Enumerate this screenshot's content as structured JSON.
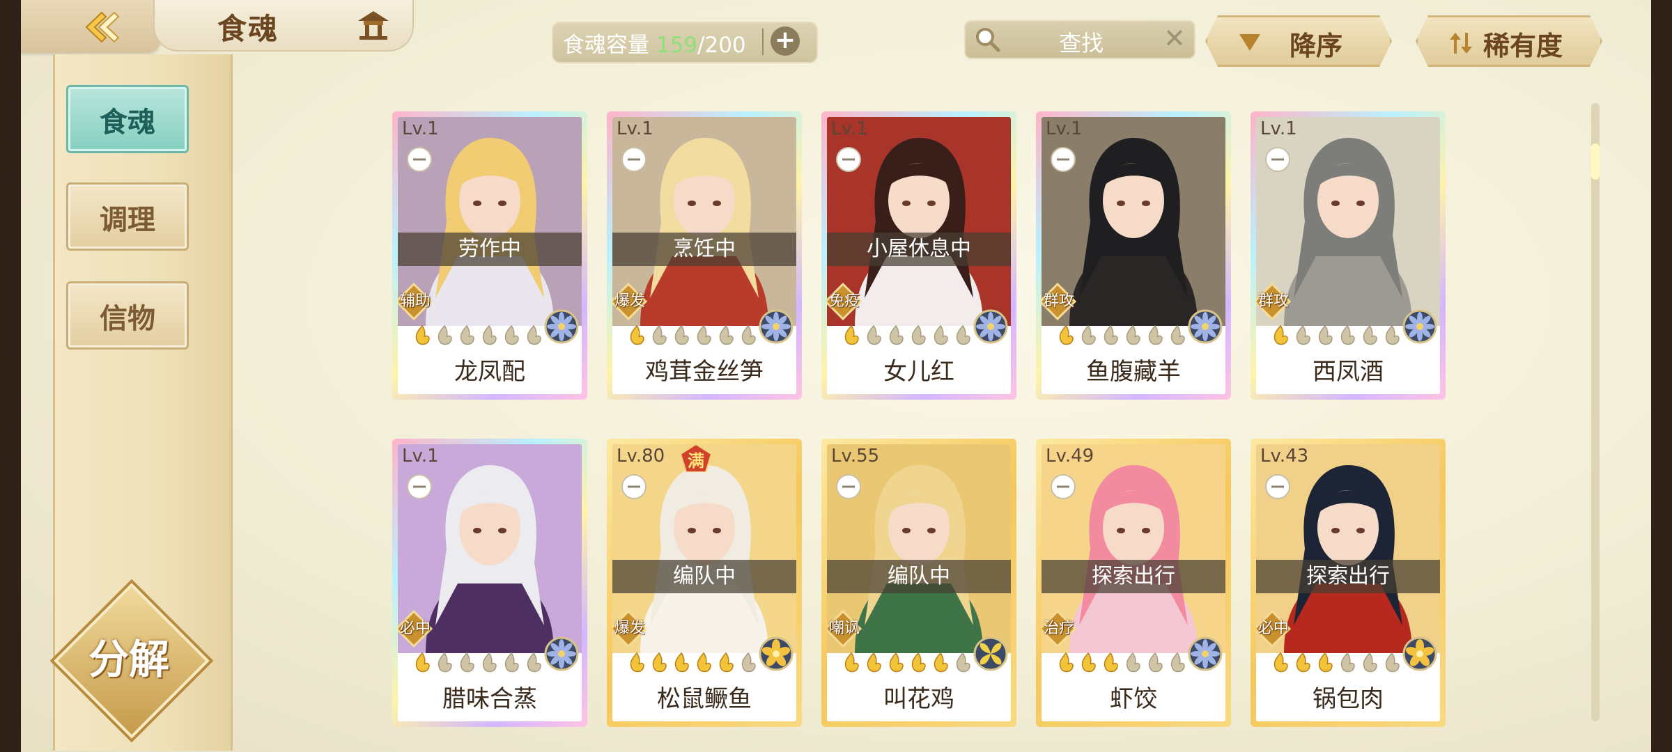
{
  "header": {
    "title": "食魂",
    "back_icon": "back-arrow-icon",
    "home_icon": "pavilion-icon",
    "capacity": {
      "label": "食魂容量",
      "current": "159",
      "max": "/200",
      "plus": "+"
    },
    "search": {
      "placeholder": "查找",
      "clear": "✕"
    },
    "sort_order": "降序",
    "sort_key": "稀有度"
  },
  "sidebar": {
    "items": [
      {
        "label": "食魂",
        "active": true
      },
      {
        "label": "调理",
        "active": false
      },
      {
        "label": "信物",
        "active": false
      }
    ],
    "decompose_label": "分解"
  },
  "cards": [
    {
      "level": "Lv.1",
      "status": "劳作中",
      "role": "辅助",
      "stars": 1,
      "element": "flower",
      "name": "龙凤配",
      "frame": "rainbow",
      "hair": "#f1cc72",
      "bg": "#b9a1b8",
      "cloth": "#e9e6ee"
    },
    {
      "level": "Lv.1",
      "status": "烹饪中",
      "role": "爆发",
      "stars": 1,
      "element": "flower",
      "name": "鸡茸金丝笋",
      "frame": "rainbow",
      "hair": "#f2dca0",
      "bg": "#c8b79b",
      "cloth": "#b93b2a"
    },
    {
      "level": "Lv.1",
      "status": "小屋休息中",
      "role": "免疫",
      "stars": 1,
      "element": "flower",
      "name": "女儿红",
      "frame": "rainbow",
      "hair": "#3a1e1a",
      "bg": "#a8342a",
      "cloth": "#f3ecec"
    },
    {
      "level": "Lv.1",
      "status": "",
      "role": "群攻",
      "stars": 1,
      "element": "flower",
      "name": "鱼腹藏羊",
      "frame": "rainbow",
      "hair": "#1f1f22",
      "bg": "#8a7d6a",
      "cloth": "#2b2626"
    },
    {
      "level": "Lv.1",
      "status": "",
      "role": "群攻",
      "stars": 1,
      "element": "flower",
      "name": "西凤酒",
      "frame": "rainbow",
      "hair": "#7d7d7a",
      "bg": "#d9d3c2",
      "cloth": "#9d9a94"
    },
    {
      "level": "Lv.1",
      "status": "",
      "role": "必中",
      "stars": 1,
      "element": "flower",
      "name": "腊味合蒸",
      "frame": "rainbow",
      "hair": "#ebebf0",
      "bg": "#c8a9d9",
      "cloth": "#4e2f62"
    },
    {
      "level": "Lv.80",
      "status": "编队中",
      "role": "爆发",
      "stars": 5,
      "element": "petal",
      "name": "松鼠鳜鱼",
      "frame": "gold",
      "hair": "#f0ece2",
      "bg": "#f4d68b",
      "cloth": "#f7f3ea",
      "max": "满"
    },
    {
      "level": "Lv.55",
      "status": "编队中",
      "role": "嘲讽",
      "stars": 5,
      "element": "leaf",
      "name": "叫花鸡",
      "frame": "gold",
      "hair": "#efd58f",
      "bg": "#eac873",
      "cloth": "#3e7448"
    },
    {
      "level": "Lv.49",
      "status": "探索出行",
      "role": "治疗",
      "stars": 3,
      "element": "flower",
      "name": "虾饺",
      "frame": "gold",
      "hair": "#f28aa0",
      "bg": "#f6d48a",
      "cloth": "#f3c8d3"
    },
    {
      "level": "Lv.43",
      "status": "探索出行",
      "role": "必中",
      "stars": 3,
      "element": "petal",
      "name": "锅包肉",
      "frame": "gold",
      "hair": "#1d2436",
      "bg": "#f1d08a",
      "cloth": "#b7281e"
    }
  ],
  "colors": {
    "accent_teal": "#86cfc1",
    "brown": "#6b4520",
    "gold": "#f6c85c"
  }
}
